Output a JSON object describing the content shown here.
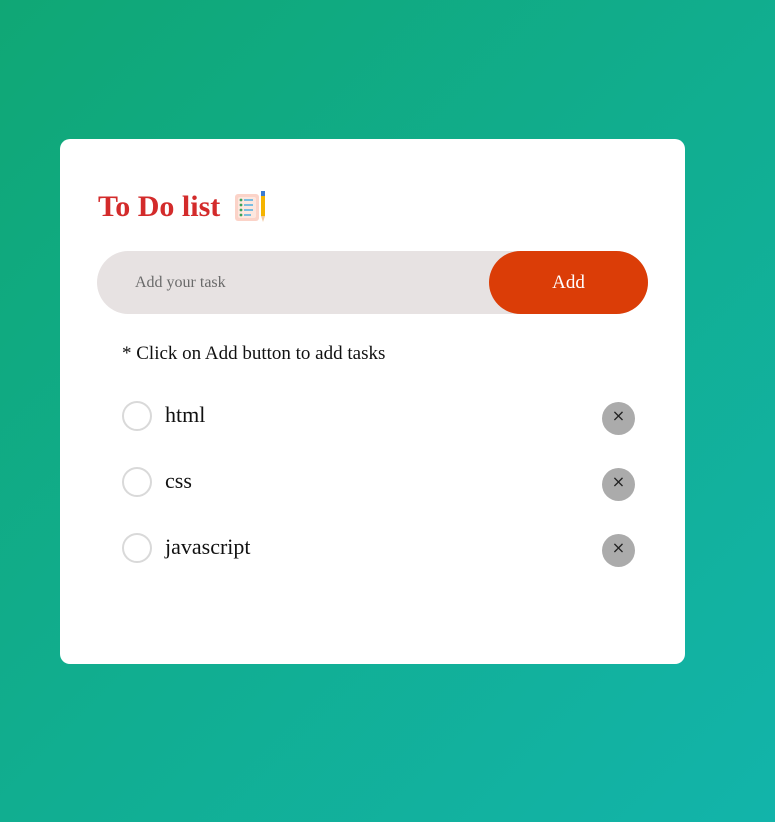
{
  "header": {
    "title": "To Do list",
    "icon": "notepad-checklist-icon"
  },
  "input": {
    "placeholder": "Add your task",
    "value": "",
    "add_label": "Add"
  },
  "hint": "* Click on Add button to add tasks",
  "tasks": [
    {
      "label": "html",
      "checked": false,
      "delete_glyph": "×"
    },
    {
      "label": "css",
      "checked": false,
      "delete_glyph": "×"
    },
    {
      "label": "javascript",
      "checked": false,
      "delete_glyph": "×"
    }
  ],
  "colors": {
    "background_start": "#10a775",
    "background_end": "#12b4aa",
    "title": "#d32b2b",
    "add_button": "#db3d07",
    "input_bg": "#e7e2e2",
    "delete_button": "#ababab"
  }
}
